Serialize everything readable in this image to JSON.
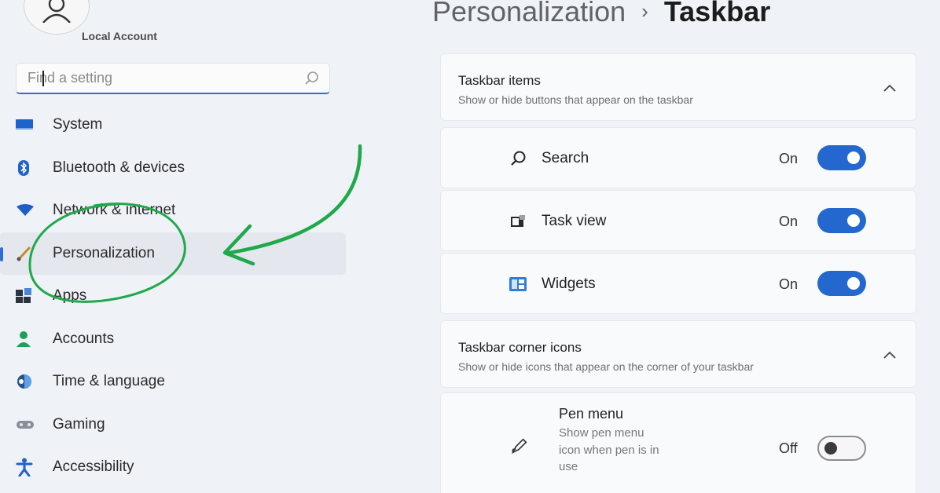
{
  "account": {
    "label": "Local Account"
  },
  "search": {
    "placeholder": "Find a setting"
  },
  "nav": {
    "items": [
      {
        "label": "System",
        "icon": "monitor-icon"
      },
      {
        "label": "Bluetooth & devices",
        "icon": "bluetooth-icon"
      },
      {
        "label": "Network & internet",
        "icon": "wifi-icon"
      },
      {
        "label": "Personalization",
        "icon": "brush-icon",
        "active": true
      },
      {
        "label": "Apps",
        "icon": "apps-icon"
      },
      {
        "label": "Accounts",
        "icon": "person-icon"
      },
      {
        "label": "Time & language",
        "icon": "globe-clock-icon"
      },
      {
        "label": "Gaming",
        "icon": "controller-icon"
      },
      {
        "label": "Accessibility",
        "icon": "accessibility-icon"
      }
    ]
  },
  "header": {
    "breadcrumb_parent": "Personalization",
    "separator": "›",
    "page_title": "Taskbar"
  },
  "taskbar_items": {
    "title": "Taskbar items",
    "subtitle": "Show or hide buttons that appear on the taskbar",
    "rows": [
      {
        "label": "Search",
        "state": "On",
        "icon": "search-icon"
      },
      {
        "label": "Task view",
        "state": "On",
        "icon": "task-view-icon"
      },
      {
        "label": "Widgets",
        "state": "On",
        "icon": "widgets-icon"
      }
    ]
  },
  "corner_icons": {
    "title": "Taskbar corner icons",
    "subtitle": "Show or hide icons that appear on the corner of your taskbar",
    "pen_menu": {
      "label": "Pen menu",
      "description": "Show pen menu icon when pen is in use",
      "state": "Off",
      "icon": "pen-icon"
    }
  },
  "colors": {
    "accent": "#2468cf",
    "annotation": "#1fa94a"
  }
}
